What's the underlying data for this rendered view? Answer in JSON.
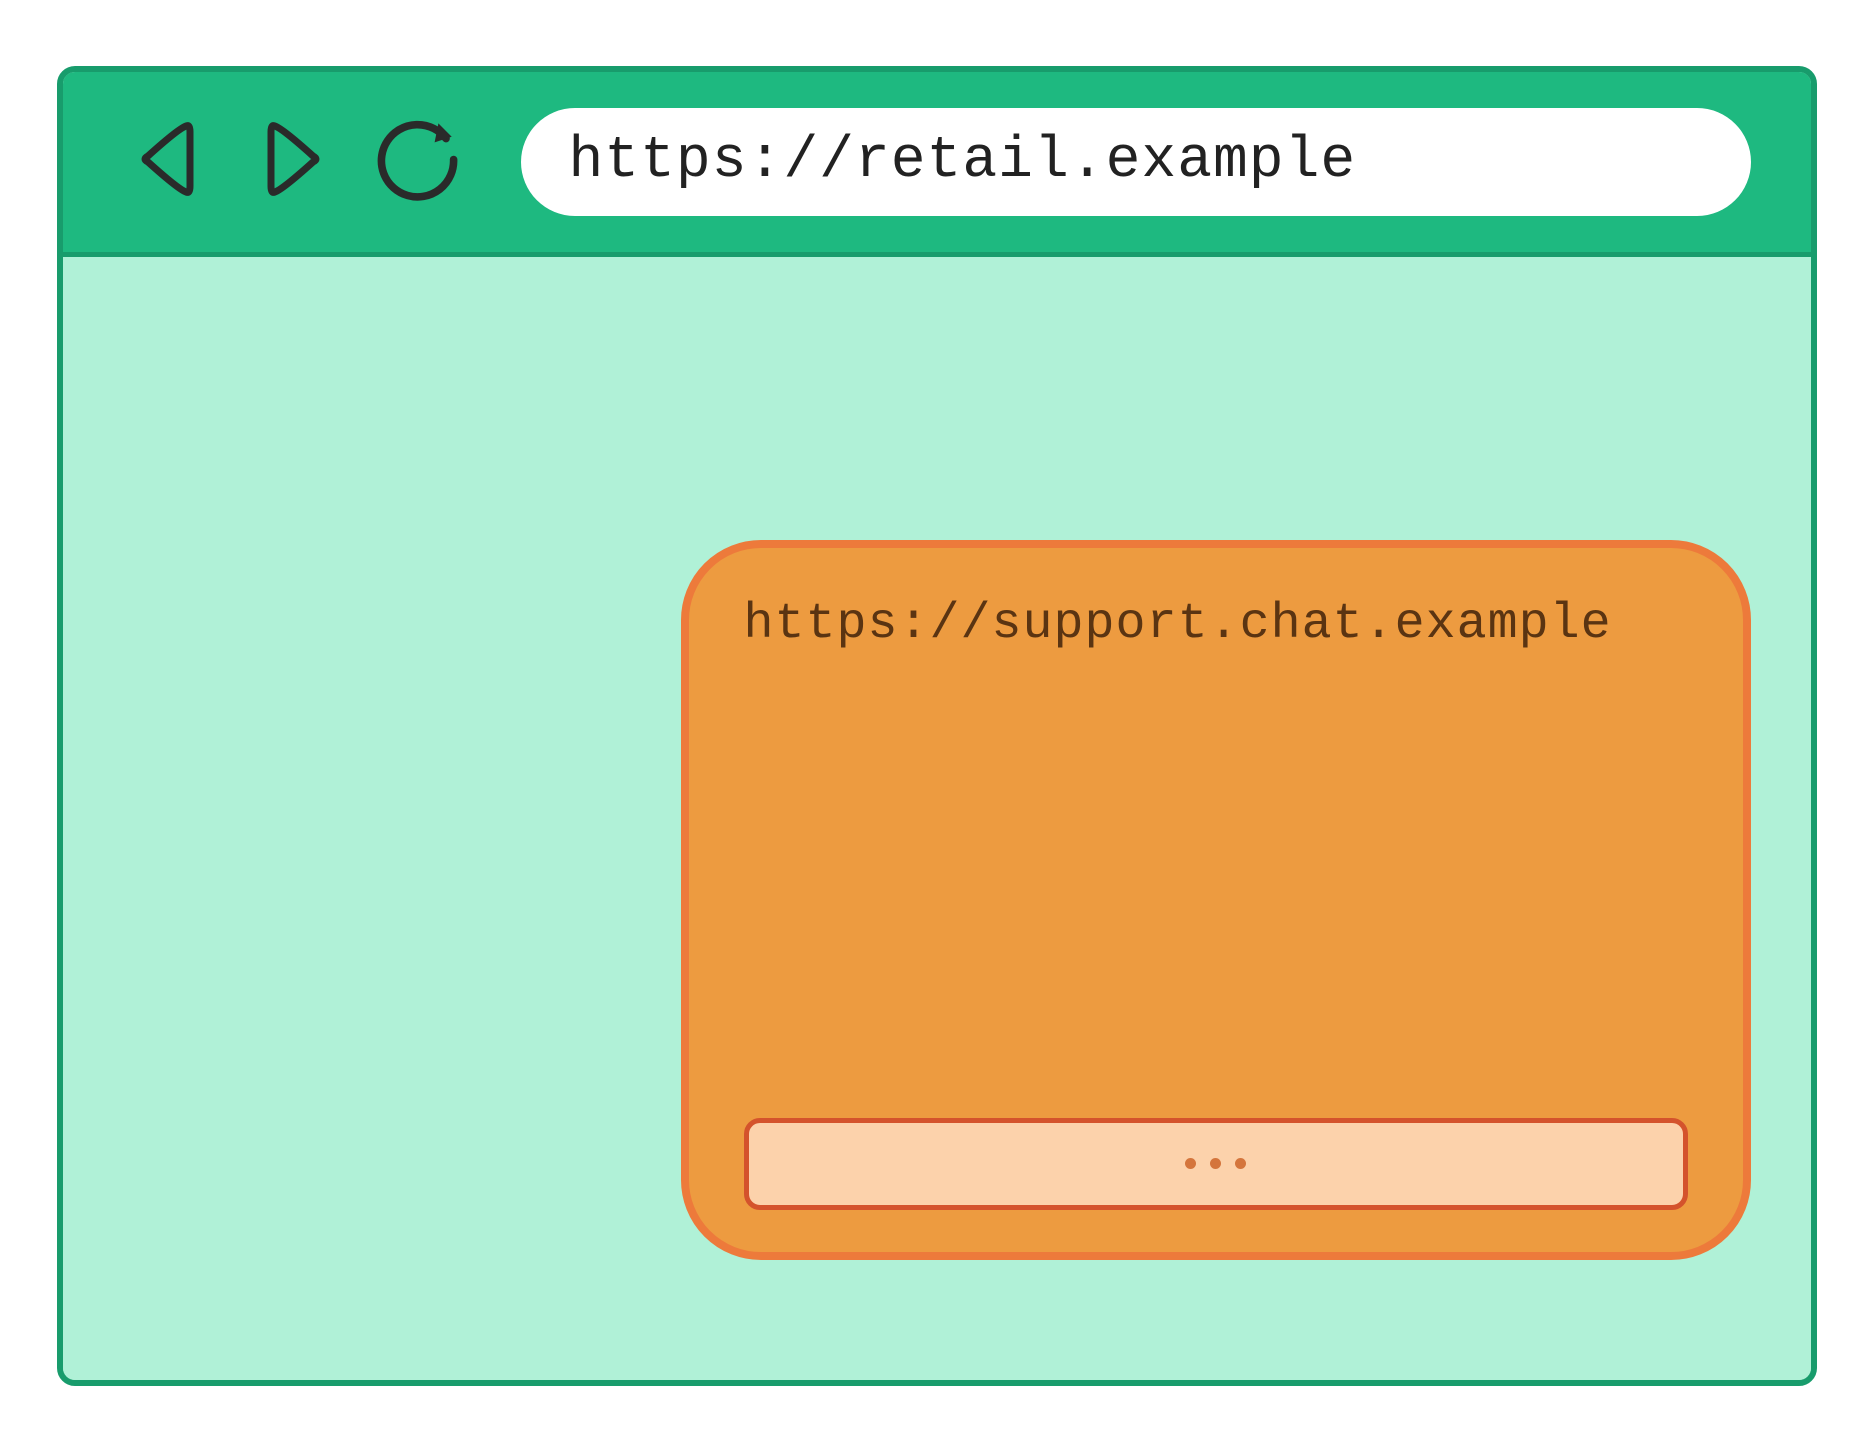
{
  "browser": {
    "address_url": "https://retail.example"
  },
  "chat_widget": {
    "origin_url": "https://support.chat.example"
  }
}
